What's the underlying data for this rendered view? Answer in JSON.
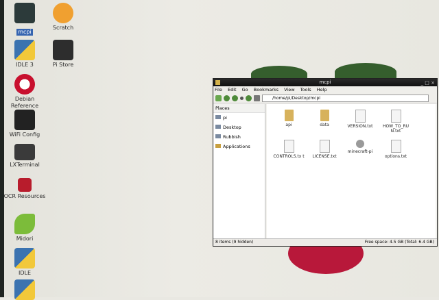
{
  "desktop": {
    "icons": [
      {
        "label": "mcpi",
        "icon": "terminal-icon"
      },
      {
        "label": "Scratch",
        "icon": "scratch-cat-icon"
      },
      {
        "label": "IDLE 3",
        "icon": "python-icon"
      },
      {
        "label": "Pi Store",
        "icon": "store-bag-icon"
      },
      {
        "label": "Debian Reference",
        "icon": "debian-icon"
      },
      {
        "label": "WiFi Config",
        "icon": "wifi-icon"
      },
      {
        "label": "LXTerminal",
        "icon": "monitor-icon"
      },
      {
        "label": "OCR Resources",
        "icon": "ocr-icon"
      },
      {
        "label": "Midori",
        "icon": "midori-leaf-icon"
      },
      {
        "label": "IDLE",
        "icon": "python-icon"
      }
    ]
  },
  "window": {
    "title": "mcpi",
    "menu": [
      "File",
      "Edit",
      "Go",
      "Bookmarks",
      "View",
      "Tools",
      "Help"
    ],
    "path": "/home/pi/Desktop/mcpi",
    "places_header": "Places",
    "places": [
      "pi",
      "Desktop",
      "Rubbish",
      "Applications"
    ],
    "files": [
      {
        "name": "api",
        "type": "folder"
      },
      {
        "name": "data",
        "type": "folder"
      },
      {
        "name": "VERSION.txt",
        "type": "doc"
      },
      {
        "name": "HOW_TO_RU N.txt",
        "type": "doc"
      },
      {
        "name": "CONTROLS.tx t",
        "type": "doc"
      },
      {
        "name": "LICENSE.txt",
        "type": "doc"
      },
      {
        "name": "minecraft-pi",
        "type": "exe"
      },
      {
        "name": "options.txt",
        "type": "doc"
      }
    ],
    "status_left": "8 items (9 hidden)",
    "status_right": "Free space: 4.5 GB (Total: 6.4 GB)"
  }
}
